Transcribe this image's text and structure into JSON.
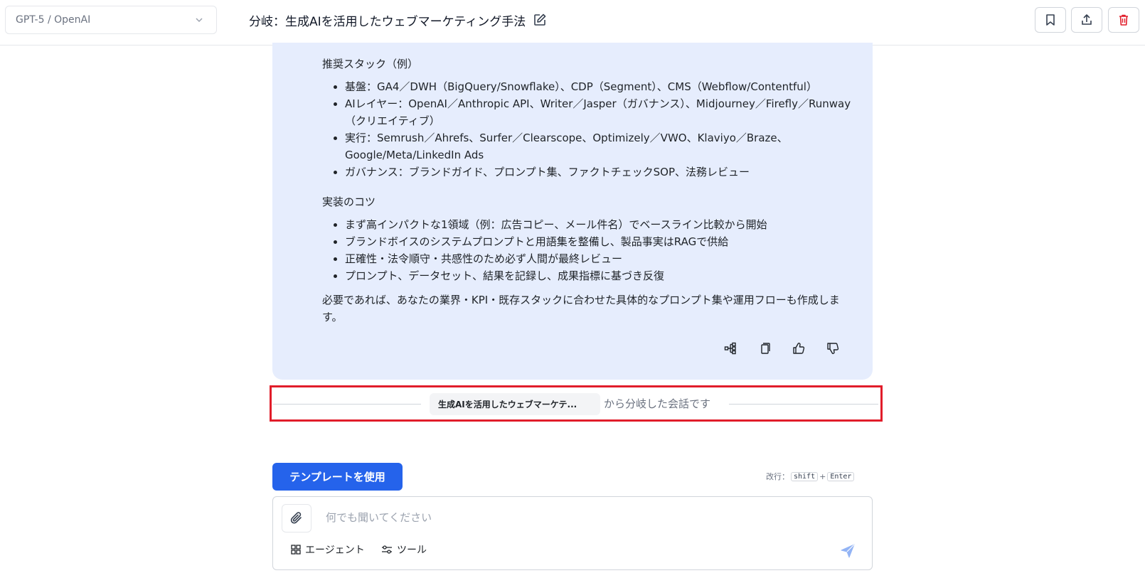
{
  "header": {
    "model_label": "GPT-5 / OpenAI",
    "title": "分岐：生成AIを活用したウェブマーケティング手法",
    "actions": [
      "bookmark-icon",
      "share-icon",
      "trash-icon"
    ],
    "danger_color": "#e11d2a"
  },
  "message": {
    "stack_heading": "推奨スタック（例）",
    "stack_items": [
      "基盤：GA4／DWH（BigQuery/Snowflake）、CDP（Segment）、CMS（Webflow/Contentful）",
      "AIレイヤー：OpenAI／Anthropic API、Writer／Jasper（ガバナンス）、Midjourney／Firefly／Runway（クリエイティブ）",
      "実行：Semrush／Ahrefs、Surfer／Clearscope、Optimizely／VWO、Klaviyo／Braze、Google/Meta/LinkedIn Ads",
      "ガバナンス：ブランドガイド、プロンプト集、ファクトチェックSOP、法務レビュー"
    ],
    "tips_heading": "実装のコツ",
    "tips_items": [
      "まず高インパクトな1領域（例：広告コピー、メール件名）でベースライン比較から開始",
      "ブランドボイスのシステムプロンプトと用語集を整備し、製品事実はRAGで供給",
      "正確性・法令順守・共感性のため必ず人間が最終レビュー",
      "プロンプト、データセット、結果を記録し、成果指標に基づき反復"
    ],
    "closing": "必要であれば、あなたの業界・KPI・既存スタックに合わせた具体的なプロンプト集や運用フローも作成します。",
    "card_color": "#e6edfd"
  },
  "branch": {
    "source_title": "生成AIを活用したウェブマーケテ...",
    "suffix": "から分岐した会話です"
  },
  "composer": {
    "template_button": "テンプレートを使用",
    "hint_label": "改行：",
    "hint_key1": "shift",
    "hint_plus": "+",
    "hint_key2": "Enter",
    "placeholder": "何でも聞いてください",
    "agent_label": "エージェント",
    "tools_label": "ツール",
    "accent_color": "#2563eb"
  }
}
